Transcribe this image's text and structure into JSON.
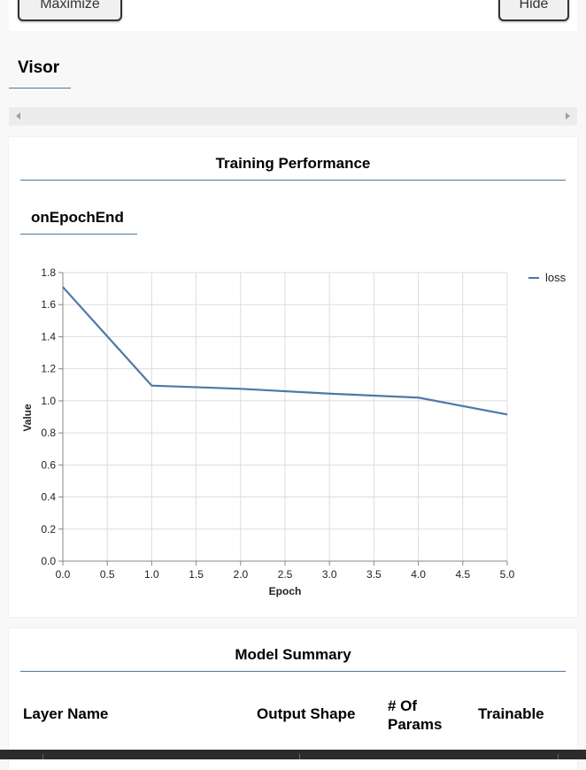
{
  "toolbar": {
    "maximize_label": "Maximize",
    "hide_label": "Hide"
  },
  "tabs": {
    "visor_label": "Visor"
  },
  "training": {
    "title": "Training Performance",
    "subtab_label": "onEpochEnd"
  },
  "chart_data": {
    "type": "line",
    "xlabel": "Epoch",
    "ylabel": "Value",
    "xlim": [
      0,
      5
    ],
    "ylim": [
      0,
      1.8
    ],
    "x_ticks": [
      "0.0",
      "0.5",
      "1.0",
      "1.5",
      "2.0",
      "2.5",
      "3.0",
      "3.5",
      "4.0",
      "4.5",
      "5.0"
    ],
    "y_ticks": [
      "0.0",
      "0.2",
      "0.4",
      "0.6",
      "0.8",
      "1.0",
      "1.2",
      "1.4",
      "1.6",
      "1.8"
    ],
    "grid": true,
    "legend_position": "top-right",
    "series": [
      {
        "name": "loss",
        "color": "#4c78a8",
        "x": [
          0,
          1,
          2,
          3,
          4,
          5
        ],
        "values": [
          1.71,
          1.095,
          1.075,
          1.045,
          1.02,
          0.915
        ]
      }
    ]
  },
  "model_summary": {
    "title": "Model Summary",
    "columns": [
      "Layer Name",
      "Output Shape",
      "# Of Params",
      "Trainable"
    ]
  }
}
